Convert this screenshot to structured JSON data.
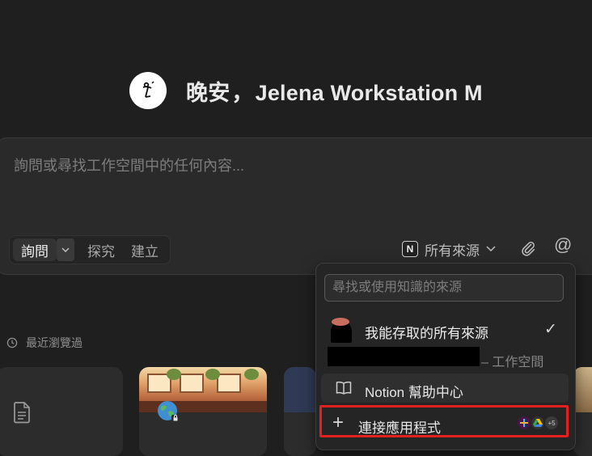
{
  "header": {
    "greeting": "晚安",
    "separator": "，",
    "workspace_name": "Jelena Workstation M"
  },
  "composer": {
    "prompt_text": "詢問或尋找工作空間中的任何內容...",
    "modes": [
      "詢問",
      "探究",
      "建立"
    ],
    "source_selector_label": "所有來源"
  },
  "recent": {
    "label": "最近瀏覽過"
  },
  "source_menu": {
    "search_placeholder": "尋找或使用知識的來源",
    "all_sources_label": "我能存取的所有來源",
    "workspace_suffix": "– 工作空間",
    "help_center_label": "Notion 幫助中心",
    "connect_apps_label": "連接應用程式",
    "apps_more": "+5"
  },
  "colors": {
    "background": "#1f1f1f",
    "highlight": "#e12020"
  }
}
